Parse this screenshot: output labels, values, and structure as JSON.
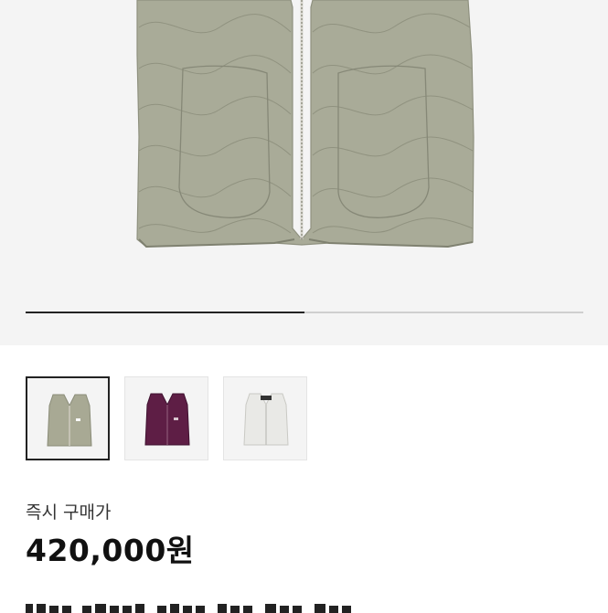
{
  "product_image": {
    "icon": "quilted-vest-image",
    "colors": {
      "background": "#f4f4f4",
      "vest_khaki": "#a9ab98",
      "stitch": "#8f917f"
    }
  },
  "carousel": {
    "current_index": 1,
    "total": 2,
    "progress_fraction": 0.5
  },
  "thumbnails": [
    {
      "icon": "vest-khaki-thumbnail",
      "color": "#a8a994",
      "selected": true
    },
    {
      "icon": "vest-purple-thumbnail",
      "color": "#5e1e45",
      "selected": false
    },
    {
      "icon": "vest-white-thumbnail",
      "color": "#e9e9e6",
      "selected": false
    }
  ],
  "price": {
    "label": "즉시 구매가",
    "value": "420,000원"
  }
}
